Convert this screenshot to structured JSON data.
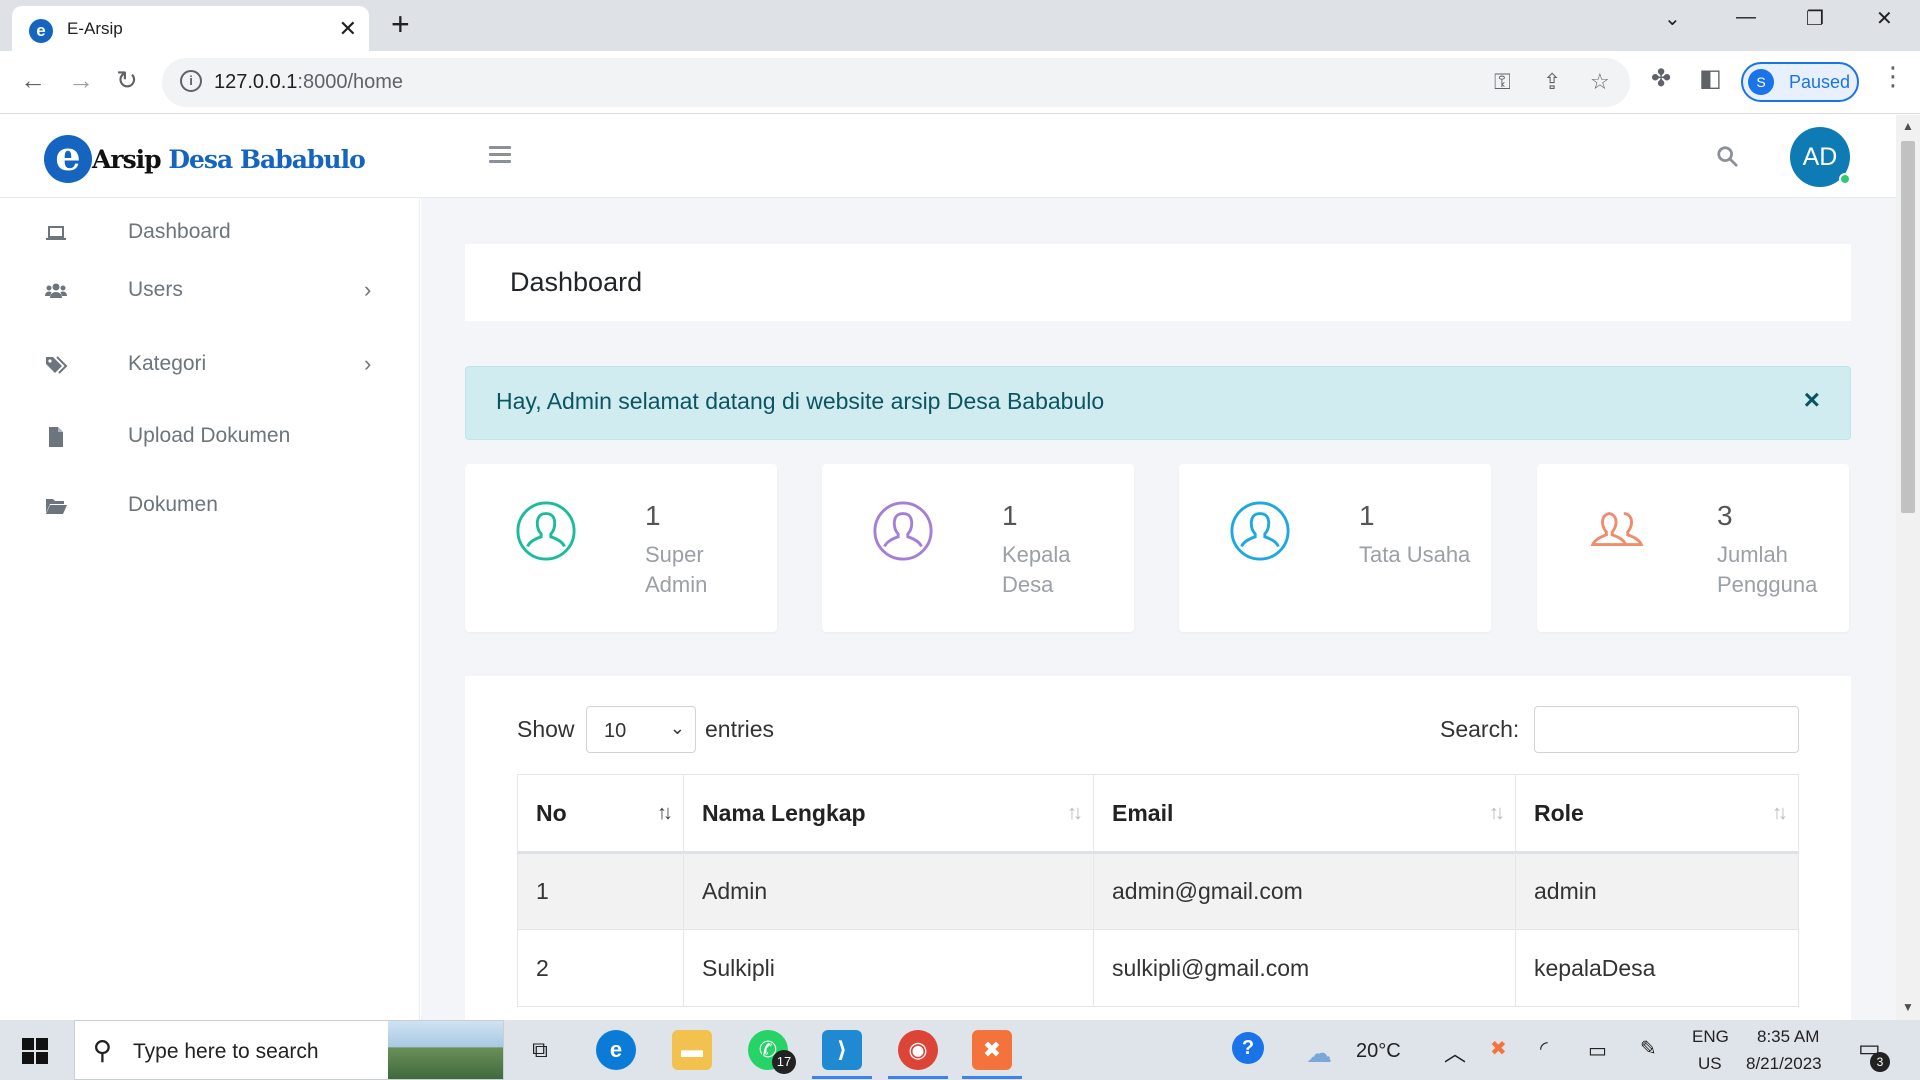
{
  "browser": {
    "tab_title": "E-Arsip",
    "favicon_letter": "e",
    "url_host": "127.0.0.1",
    "url_path": ":8000/home",
    "profile_letter": "S",
    "profile_label": "Paused"
  },
  "header": {
    "logo_letter": "e",
    "logo_part1": "Arsip",
    "logo_part2": "Desa Bababulo",
    "avatar_initials": "AD"
  },
  "sidebar": {
    "items": [
      {
        "label": "Dashboard",
        "icon": "laptop-icon",
        "has_submenu": false
      },
      {
        "label": "Users",
        "icon": "users-icon",
        "has_submenu": true
      },
      {
        "label": "Kategori",
        "icon": "tags-icon",
        "has_submenu": true
      },
      {
        "label": "Upload Dokumen",
        "icon": "file-icon",
        "has_submenu": false
      },
      {
        "label": "Dokumen",
        "icon": "folder-open-icon",
        "has_submenu": false
      }
    ]
  },
  "main": {
    "page_title": "Dashboard",
    "alert_text": "Hay, Admin selamat datang di website arsip Desa Bababulo",
    "alert_close": "×",
    "stats": [
      {
        "value": "1",
        "label": "Super Admin",
        "color": "#1abc9c"
      },
      {
        "value": "1",
        "label": "Kepala Desa",
        "color": "#a37fd6"
      },
      {
        "value": "1",
        "label": "Tata Usaha",
        "color": "#1fa8e0"
      },
      {
        "value": "3",
        "label": "Jumlah Pengguna",
        "color": "#f08c6e"
      }
    ],
    "table": {
      "show_label": "Show",
      "page_size": "10",
      "entries_label": "entries",
      "search_label": "Search:",
      "search_value": "",
      "columns": [
        "No",
        "Nama Lengkap",
        "Email",
        "Role"
      ],
      "rows": [
        [
          "1",
          "Admin",
          "admin@gmail.com",
          "admin"
        ],
        [
          "2",
          "Sulkipli",
          "sulkipli@gmail.com",
          "kepalaDesa"
        ]
      ]
    }
  },
  "taskbar": {
    "search_placeholder": "Type here to search",
    "whatsapp_badge": "17",
    "weather": "20°C",
    "lang_line1": "ENG",
    "lang_line2": "US",
    "time": "8:35 AM",
    "date": "8/21/2023",
    "notification_count": "3"
  },
  "colors": {
    "brand": "#1565c0",
    "alert_bg": "#d1ecf1",
    "alert_text": "#0c5460",
    "avatar_bg": "#0f7bb5"
  }
}
